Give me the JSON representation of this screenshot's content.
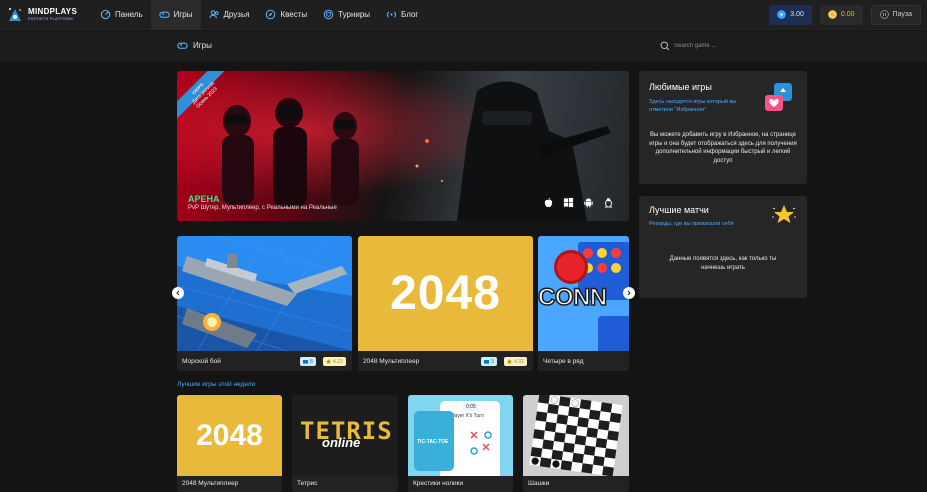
{
  "logo": {
    "name": "MINDPLAYS",
    "subtitle": "ESPORTS PLATFORM"
  },
  "nav": [
    {
      "label": "Панель",
      "icon": "dashboard-icon"
    },
    {
      "label": "Игры",
      "icon": "gamepad-icon"
    },
    {
      "label": "Друзья",
      "icon": "friends-icon"
    },
    {
      "label": "Квесты",
      "icon": "compass-icon"
    },
    {
      "label": "Турниры",
      "icon": "trophy-icon"
    },
    {
      "label": "Блог",
      "icon": "broadcast-icon"
    }
  ],
  "header_right": {
    "balance": "3.00",
    "coins": "0.00",
    "pause": "Пауза"
  },
  "page": {
    "title": "Игры",
    "search_placeholder": "Search game ..."
  },
  "hero": {
    "ribbon": "СКОРО",
    "date_line1": "Дата релиза:",
    "date_line2": "Осень 2023",
    "title": "АРЕНА",
    "subtitle": "PvP Шутер, Мультиплеер, с Реальными на Реальные"
  },
  "favorites": {
    "title": "Любимые игры",
    "link": "Здесь находятся игры который вы отметили \"Избранное\"",
    "text": "Вы можете добавить игру в Избранное, на странице игры и она будет отображаться здесь для получения дополнительной информации быстрый и легкий доступ"
  },
  "best_matches": {
    "title": "Лучшие матчи",
    "link": "Рекорды, где вы превзошли себя",
    "text": "Данные появятся здесь, как только ты начнешь играть"
  },
  "featured": [
    {
      "name": "Морской бой",
      "players": "8",
      "rating": "4.22"
    },
    {
      "name": "2048 Мультиплеер",
      "cover_text": "2048",
      "players": "3",
      "rating": "4.32"
    },
    {
      "name": "Четыре в ряд",
      "cover_text": "CONN"
    }
  ],
  "week_label": "Лучшие игры этой недели",
  "week_games": [
    {
      "name": "2048 Мультиплеер",
      "cover_text": "2048"
    },
    {
      "name": "Тетрис",
      "cover_text": "TETRIS",
      "cover_sub": "online"
    },
    {
      "name": "Крестики нолики",
      "cover_text": "TIC-TAC-TOE",
      "cover_time": "0:05",
      "cover_turn": "Player X's Turn"
    },
    {
      "name": "Шашки"
    }
  ],
  "colors": {
    "accent": "#49a7ff",
    "green": "#44e08a",
    "yellow": "#e8b93a"
  }
}
